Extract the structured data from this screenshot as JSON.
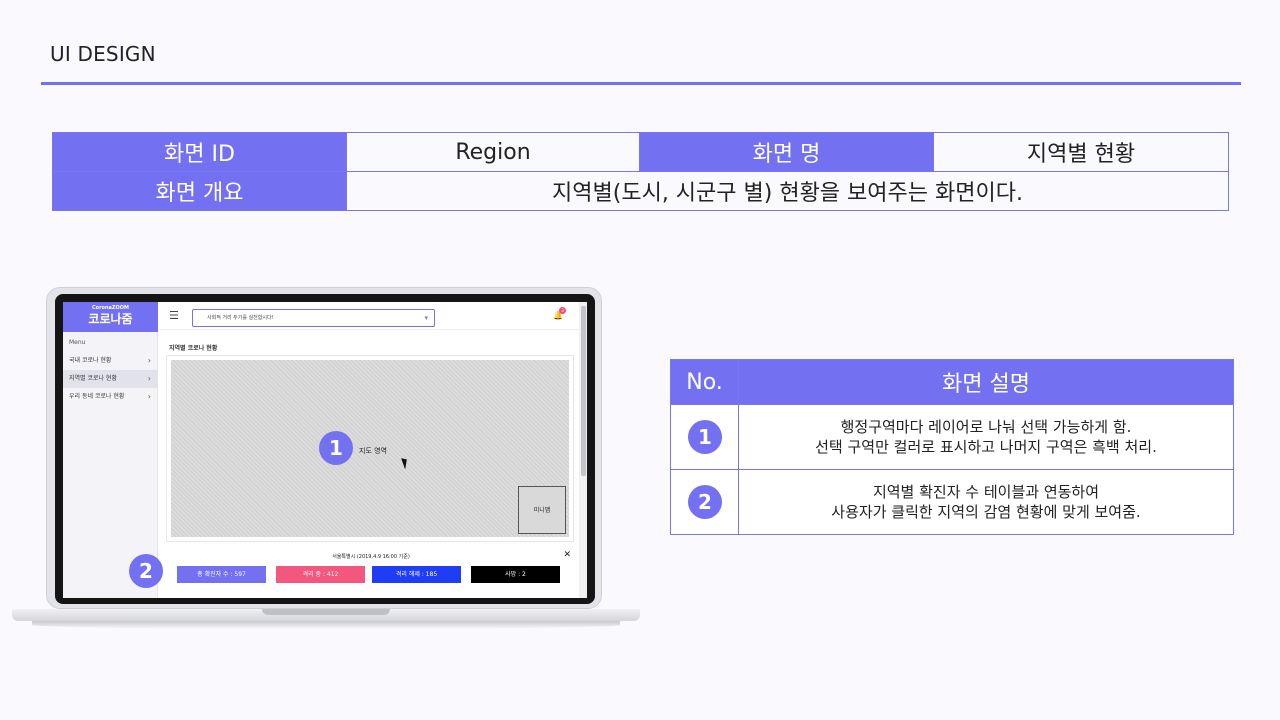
{
  "slide": {
    "title": "UI DESIGN"
  },
  "info_table": {
    "screen_id_label": "화면 ID",
    "screen_id_value": "Region",
    "screen_name_label": "화면 명",
    "screen_name_value": "지역별 현황",
    "overview_label": "화면 개요",
    "overview_value": "지역별(도시, 시군구 별) 현황을 보여주는 화면이다."
  },
  "app": {
    "logo_top": "CoronaZOOM",
    "logo_main": "코로나줌",
    "menu_caption": "Menu",
    "menu_items": [
      {
        "label": "국내 코로나 현황",
        "chevron": "›"
      },
      {
        "label": "지역별 코로나 현황",
        "chevron": "›"
      },
      {
        "label": "우리 동네 코로나 현황",
        "chevron": "›"
      }
    ],
    "hamburger": "☰",
    "notice": "사회적 거리 두기를 실천합시다!",
    "notice_caret": "▾",
    "bell": "🔔",
    "bell_count": "3",
    "page_heading": "지역별 코로나 현황",
    "map_label": "지도 영역",
    "minimap_label": "미니맵",
    "stat_title": "서울특별시 (2019.4.9 16:00 기준)",
    "stat_close": "✕",
    "stats": [
      {
        "label": "총 확진자 수 : 597",
        "color": "#7470f2"
      },
      {
        "label": "격리 중 : 412",
        "color": "#f4577e"
      },
      {
        "label": "격리 해제 : 185",
        "color": "#1f3df5"
      },
      {
        "label": "사망 : 2",
        "color": "#000000"
      }
    ]
  },
  "markers": {
    "one": "1",
    "two": "2"
  },
  "description": {
    "header_no": "No.",
    "header_desc": "화면 설명",
    "rows": [
      {
        "no": "1",
        "line1": "행정구역마다 레이어로 나눠 선택 가능하게 함.",
        "line2": "선택 구역만 컬러로 표시하고 나머지 구역은 흑백 처리."
      },
      {
        "no": "2",
        "line1": "지역별 확진자 수 테이블과 연동하여",
        "line2": "사용자가 클릭한 지역의 감염 현황에 맞게 보여줌."
      }
    ]
  },
  "colors": {
    "accent": "#7470f2"
  }
}
